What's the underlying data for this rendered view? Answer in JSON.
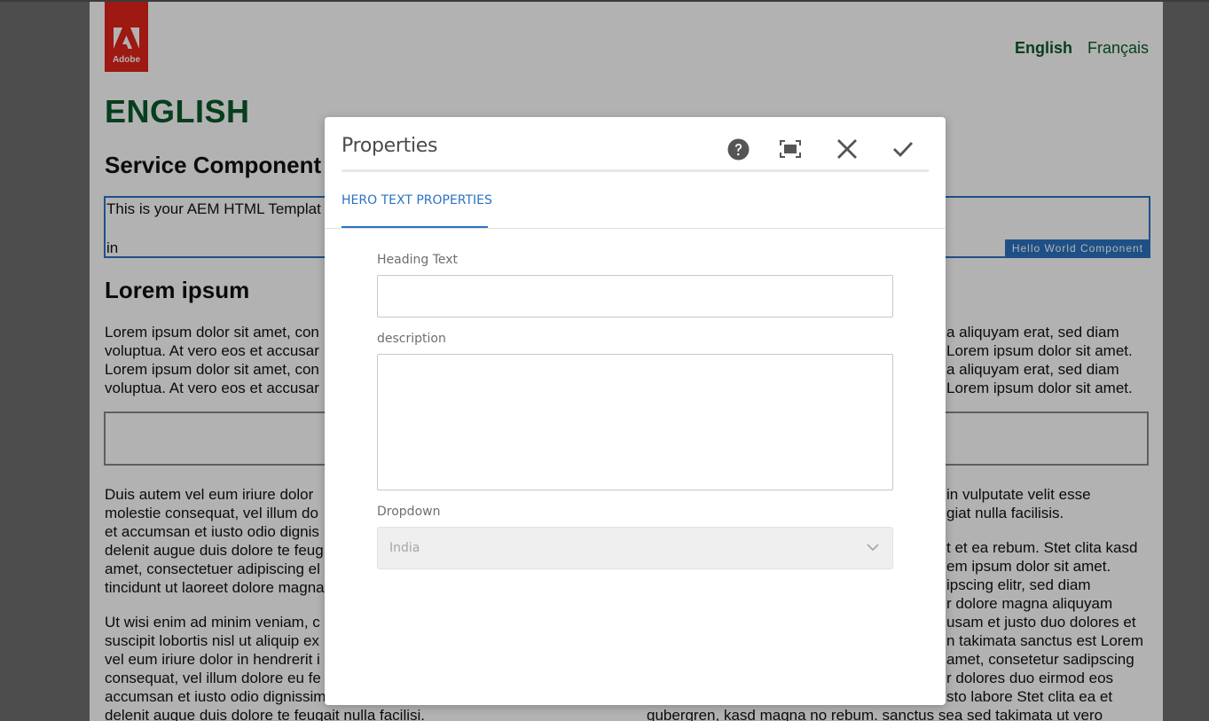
{
  "page": {
    "brand": "Adobe",
    "languages": [
      {
        "label": "English",
        "active": true
      },
      {
        "label": "Français",
        "active": false
      }
    ],
    "heading_main": "ENGLISH",
    "heading_service": "Service Component",
    "hello_component": {
      "line1": "This is your AEM HTML Templat",
      "line2": "in",
      "badge": "Hello World Component"
    },
    "heading_lorem": "Lorem ipsum",
    "lorem_left_lines": [
      "Lorem ipsum dolor sit amet, con",
      "voluptua. At vero eos et accusar",
      "Lorem ipsum dolor sit amet, con",
      "voluptua. At vero eos et accusar"
    ],
    "lorem_right_lines": [
      "a aliquyam erat, sed diam",
      "Lorem ipsum dolor sit amet.",
      "a aliquyam erat, sed diam",
      "Lorem ipsum dolor sit amet."
    ],
    "col1_para1_lines": [
      "Duis autem vel eum iriure dolor",
      "molestie consequat, vel illum do",
      "et accumsan et iusto odio dignis",
      "delenit augue duis dolore te feug",
      "amet, consectetuer adipiscing el",
      "tincidunt ut laoreet dolore magna"
    ],
    "col1_para2_lines": [
      "Ut wisi enim ad minim veniam, c",
      "suscipit lobortis nisl ut aliquip ex",
      "vel eum iriure dolor in hendrerit i",
      "consequat, vel illum dolore eu fe",
      "accumsan et iusto odio dignissim",
      "delenit augue duis dolore te feugait nulla facilisi."
    ],
    "col2_para1_lines": [
      "in vulputate velit esse",
      "giat nulla facilisis."
    ],
    "col2_para2_lines": [
      "t et ea rebum. Stet clita kasd",
      "em ipsum dolor sit amet.",
      "ipscing elitr, sed diam",
      "r dolore magna aliquyam",
      "usam et justo duo dolores et",
      "n takimata sanctus est Lorem",
      "amet, consetetur sadipscing",
      "r dolores duo eirmod eos",
      "sto labore Stet clita ea et",
      "gubergren, kasd magna no rebum. sanctus sea sed takimata ut vero"
    ]
  },
  "dialog": {
    "title": "Properties",
    "tab": "HERO TEXT PROPERTIES",
    "fields": {
      "heading_label": "Heading Text",
      "heading_value": "",
      "description_label": "description",
      "description_value": "",
      "dropdown_label": "Dropdown",
      "dropdown_value": "India"
    },
    "icons": [
      "help-icon",
      "fullscreen-icon",
      "close-icon",
      "checkmark-icon"
    ]
  },
  "colors": {
    "heading_green": "#0b5a2a",
    "accent_blue": "#2b73c2",
    "adobe_red": "#e1251b"
  }
}
